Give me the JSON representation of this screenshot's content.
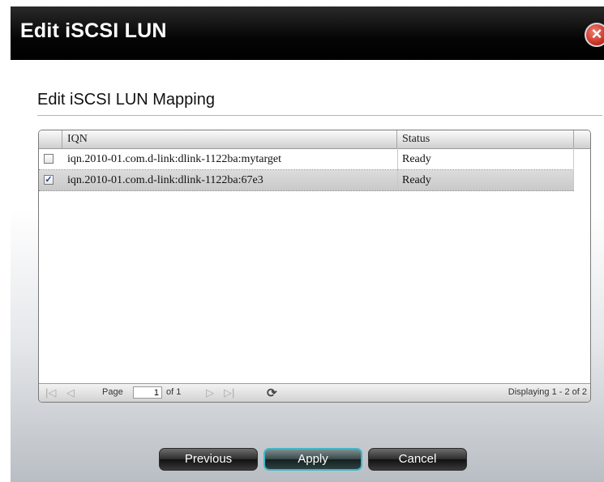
{
  "dialog": {
    "title": "Edit iSCSI LUN",
    "close_icon": "close-icon",
    "section_title": "Edit iSCSI LUN Mapping"
  },
  "grid": {
    "columns": [
      "IQN",
      "Status"
    ],
    "rows": [
      {
        "checked": false,
        "iqn": "iqn.2010-01.com.d-link:dlink-1122ba:mytarget",
        "status": "Ready"
      },
      {
        "checked": true,
        "iqn": "iqn.2010-01.com.d-link:dlink-1122ba:67e3",
        "status": "Ready"
      }
    ]
  },
  "pager": {
    "page_label": "Page",
    "page_value": "1",
    "of_label": "of 1",
    "info": "Displaying 1 - 2 of 2",
    "icons": [
      "first-page-icon",
      "prev-page-icon",
      "next-page-icon",
      "last-page-icon",
      "refresh-icon"
    ]
  },
  "buttons": {
    "previous": "Previous",
    "apply": "Apply",
    "cancel": "Cancel"
  },
  "colors": {
    "titlebar": "#000000",
    "close": "#c8362a",
    "apply_border": "#3fb7c9"
  }
}
